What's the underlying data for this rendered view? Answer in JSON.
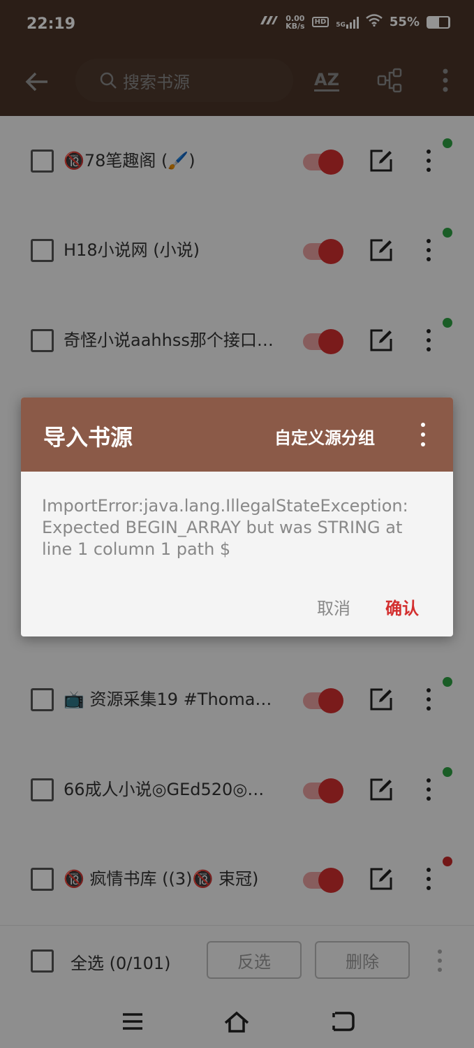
{
  "status_bar": {
    "time": "22:19",
    "net_speed_value": "0.00",
    "net_speed_unit": "KB/s",
    "hd": "HD",
    "network": "5G",
    "battery": "55%"
  },
  "toolbar": {
    "search_placeholder": "搜索书源",
    "sort_label": "AZ"
  },
  "sources": [
    {
      "name": "🔞78笔趣阁 (🖌️)",
      "enabled": true,
      "status_color": "#2ea043"
    },
    {
      "name": "H18小说网 (小说)",
      "enabled": true,
      "status_color": "#2ea043"
    },
    {
      "name": "奇怪小说aahhss那个接口…",
      "enabled": true,
      "status_color": "#2ea043"
    },
    {
      "name": "📺 资源采集19  #Thoma…",
      "enabled": true,
      "status_color": "#2ea043"
    },
    {
      "name": "66成人小说◎GEd520◎…",
      "enabled": true,
      "status_color": "#2ea043"
    },
    {
      "name": "🔞 疯情书库 ((3)🔞  束冠)",
      "enabled": true,
      "status_color": "#c62828"
    }
  ],
  "bottom_bar": {
    "select_all_label": "全选 (0/101)",
    "invert_label": "反选",
    "delete_label": "删除"
  },
  "dialog": {
    "title": "导入书源",
    "action_label": "自定义源分组",
    "message": "ImportError:java.lang.IllegalStateException: Expected BEGIN_ARRAY but was STRING at line 1 column 1 path $",
    "cancel_label": "取消",
    "confirm_label": "确认"
  },
  "colors": {
    "toolbar": "#4a3529",
    "dialog_header": "#8b5a48",
    "accent": "#d32f2f"
  }
}
